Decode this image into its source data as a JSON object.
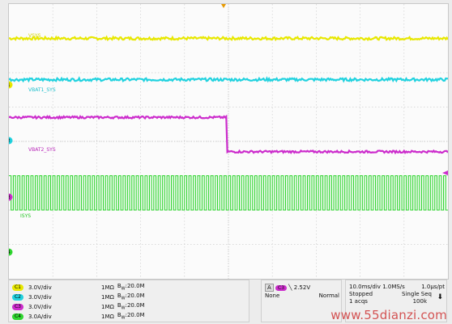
{
  "chart_data": {
    "type": "line",
    "grid": true,
    "x_range": [
      -50,
      50
    ],
    "divisions": {
      "x": 10,
      "y": 8
    },
    "series": [
      {
        "name": "VSYS",
        "color": "#e8e800",
        "kind": "flat",
        "level": 3.0,
        "noise": 0.08
      },
      {
        "name": "VBAT1_SYS",
        "color": "#21d2df",
        "kind": "flat",
        "level": 1.8,
        "noise": 0.08
      },
      {
        "name": "VBAT2_SYS",
        "color": "#cc2ccc",
        "kind": "step",
        "before": 0.7,
        "after": -0.3,
        "step_at": -0.4,
        "noise": 0.06
      },
      {
        "name": "ISYS",
        "color": "#2fd62f",
        "kind": "square",
        "high": -1.0,
        "low": -2.0,
        "period": 1.0
      }
    ]
  },
  "trace_labels": {
    "ch1": "VSYS",
    "ch2": "VBAT1_SYS",
    "ch3": "VBAT2_SYS",
    "ch4": "ISYS"
  },
  "markers": {
    "ch1": "1",
    "ch2": "2",
    "ch3": "3",
    "ch4": "4"
  },
  "channels": [
    {
      "id": "C1",
      "scale": "3.0V/div",
      "coupling": "1MΩ",
      "bw": "B",
      "bw_sub": "W",
      "bw_val": ":20.0M",
      "color": "#e8e800"
    },
    {
      "id": "C2",
      "scale": "3.0V/div",
      "coupling": "1MΩ",
      "bw": "B",
      "bw_sub": "W",
      "bw_val": ":20.0M",
      "color": "#21d2df"
    },
    {
      "id": "C3",
      "scale": "3.0V/div",
      "coupling": "1MΩ",
      "bw": "B",
      "bw_sub": "W",
      "bw_val": ":20.0M",
      "color": "#cc2ccc"
    },
    {
      "id": "C4",
      "scale": "3.0A/div",
      "coupling": "1MΩ",
      "bw": "B",
      "bw_sub": "W",
      "bw_val": ":20.0M",
      "color": "#2fd62f"
    }
  ],
  "trigger": {
    "source_tag": "A",
    "channel": "C3",
    "slope": "╲",
    "level": "2.52V",
    "mode_left": "None",
    "mode_right": "Normal"
  },
  "timebase": {
    "scale": "10.0ms/div",
    "rate": "1.0MS/s",
    "resolution": "1.0µs/pt",
    "state": "Stopped",
    "seq": "Single Seq",
    "acq": "1 acqs",
    "rl": "100k"
  },
  "watermark": "www.55dianzi.com"
}
